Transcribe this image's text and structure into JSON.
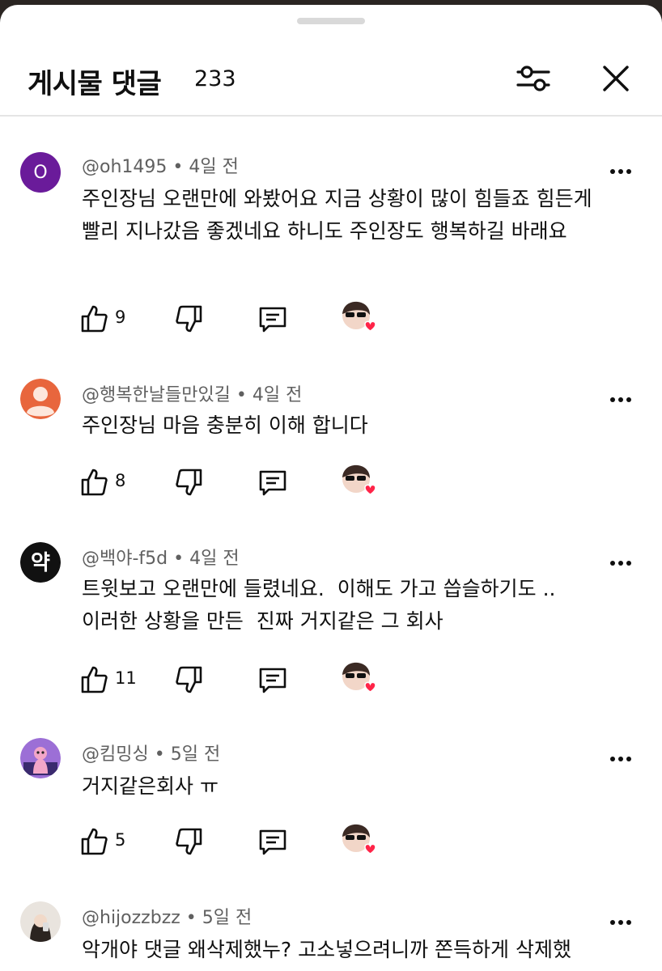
{
  "header": {
    "title": "게시물 댓글",
    "count": "233",
    "filter_icon": "sliders-icon",
    "close_icon": "close-icon"
  },
  "comments": [
    {
      "author": "@oh1495",
      "time": "4일 전",
      "avatar_letter": "O",
      "text": "주인장님 오랜만에 와봤어요 지금 상황이 많이 힘들죠 힘든게 빨리 지나갔음 좋겠네요 하니도 주인장도 행복하길 바래요",
      "likes": "9"
    },
    {
      "author": "@행복한날들만있길",
      "time": "4일 전",
      "text": "주인장님 마음 충분히 이해 합니다",
      "likes": "8"
    },
    {
      "author": "@백야-f5d",
      "time": "4일 전",
      "avatar_letter": "약",
      "text": "트윗보고 오랜만에 들렸네요.  이해도 가고 씁슬하기도 ..  이러한 상황을 만든  진짜 거지같은 그 회사",
      "likes": "11"
    },
    {
      "author": "@킴밍싱",
      "time": "5일 전",
      "text": "거지같은회사 ㅠ",
      "likes": "5"
    },
    {
      "author": "@hijozzbzz",
      "time": "5일 전",
      "text": "악개야 댓글 왜삭제했누? 고소넣으려니까 쫀득하게 삭제했"
    }
  ],
  "colors": {
    "accent_purple": "#6a1b9a",
    "heart_red": "#ff2448",
    "meta_gray": "#606060"
  }
}
